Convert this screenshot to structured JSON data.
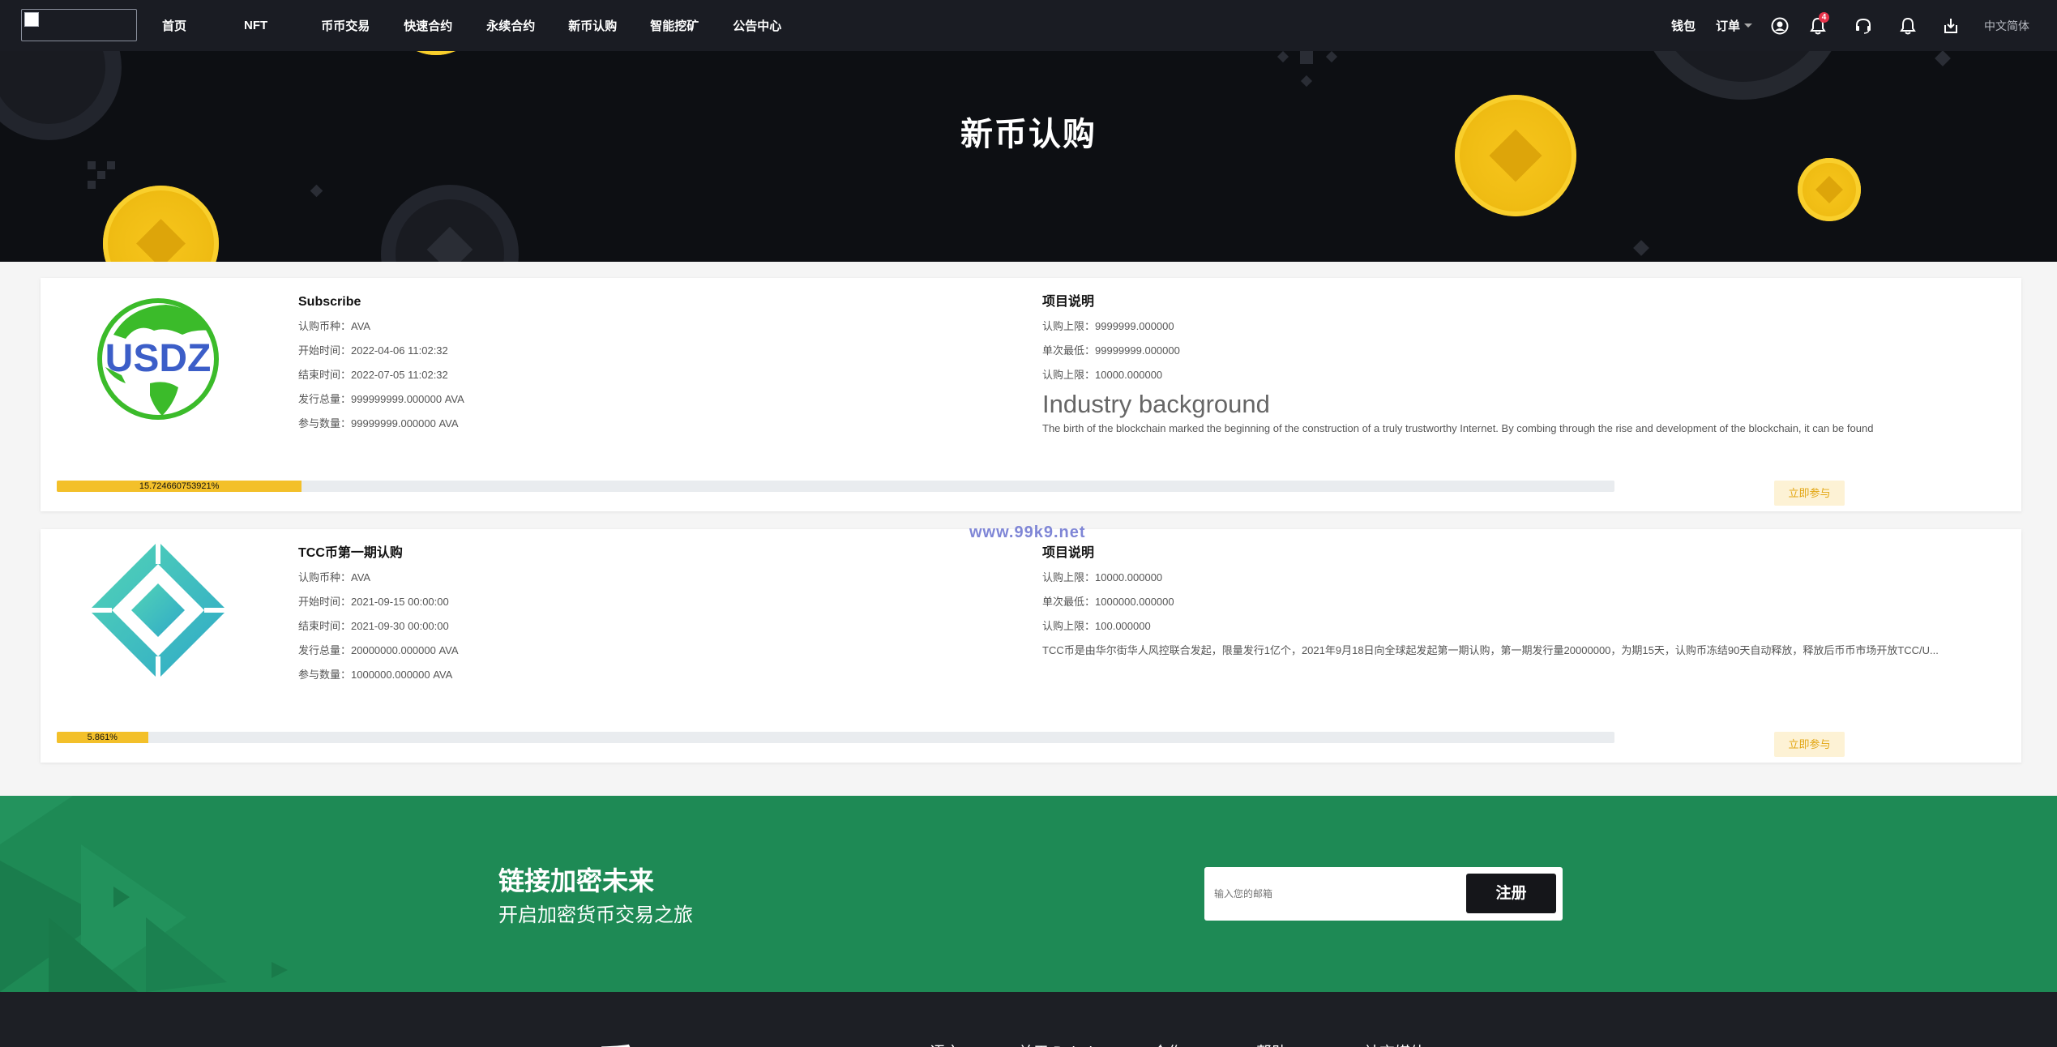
{
  "nav": {
    "items": [
      "首页",
      "NFT",
      "币币交易",
      "快速合约",
      "永续合约",
      "新币认购",
      "智能挖矿",
      "公告中心"
    ],
    "wallet": "钱包",
    "orders": "订单",
    "notif_count": "4",
    "language": "中文简体"
  },
  "banner": {
    "title": "新币认购"
  },
  "cards": [
    {
      "logo_text": "USDZ",
      "title": "Subscribe",
      "currency_label": "认购币种：",
      "currency": "AVA",
      "start_label": "开始时间：",
      "start": "2022-04-06 11:02:32",
      "end_label": "结束时间：",
      "end": "2022-07-05 11:02:32",
      "total_label": "发行总量：",
      "total": "999999999.000000 AVA",
      "joined_label": "参与数量：",
      "joined": "99999999.000000 AVA",
      "desc_title": "项目说明",
      "limit_label": "认购上限：",
      "limit": "9999999.000000",
      "min_label": "单次最低：",
      "min": "99999999.000000",
      "limit2_label": "认购上限：",
      "limit2": "10000.000000",
      "industry_head": "Industry background",
      "industry_text": "The birth of the blockchain marked the beginning of the construction of a truly trustworthy Internet. By combing through the rise and development of the blockchain, it can be found",
      "progress": 15.724660753921,
      "progress_label": "15.724660753921%",
      "join_label": "立即参与"
    },
    {
      "title": "TCC币第一期认购",
      "currency_label": "认购币种：",
      "currency": "AVA",
      "start_label": "开始时间：",
      "start": "2021-09-15 00:00:00",
      "end_label": "结束时间：",
      "end": "2021-09-30 00:00:00",
      "total_label": "发行总量：",
      "total": "20000000.000000 AVA",
      "joined_label": "参与数量：",
      "joined": "1000000.000000 AVA",
      "desc_title": "项目说明",
      "limit_label": "认购上限：",
      "limit": "10000.000000",
      "min_label": "单次最低：",
      "min": "1000000.000000",
      "limit2_label": "认购上限：",
      "limit2": "100.000000",
      "desc_text": "TCC币是由华尔街华人风控联合发起，限量发行1亿个，2021年9月18日向全球起发起第一期认购，第一期发行量20000000，为期15天，认购币冻结90天自动释放，释放后币币市场开放TCC/U...",
      "progress": 5.861,
      "progress_label": "5.861%",
      "join_label": "立即参与"
    }
  ],
  "watermark": "www.99k9.net",
  "cta": {
    "title": "链接加密未来",
    "subtitle": "开启加密货币交易之旅",
    "email_placeholder": "输入您的邮箱",
    "register_label": "注册"
  },
  "footer": {
    "brand": "币",
    "links": [
      "语言",
      "关于 Bubai",
      "合作",
      "帮助",
      "社交媒体"
    ]
  },
  "colors": {
    "accent": "#f3c02a",
    "green": "#1e8a55",
    "dark": "#1a1c23"
  }
}
